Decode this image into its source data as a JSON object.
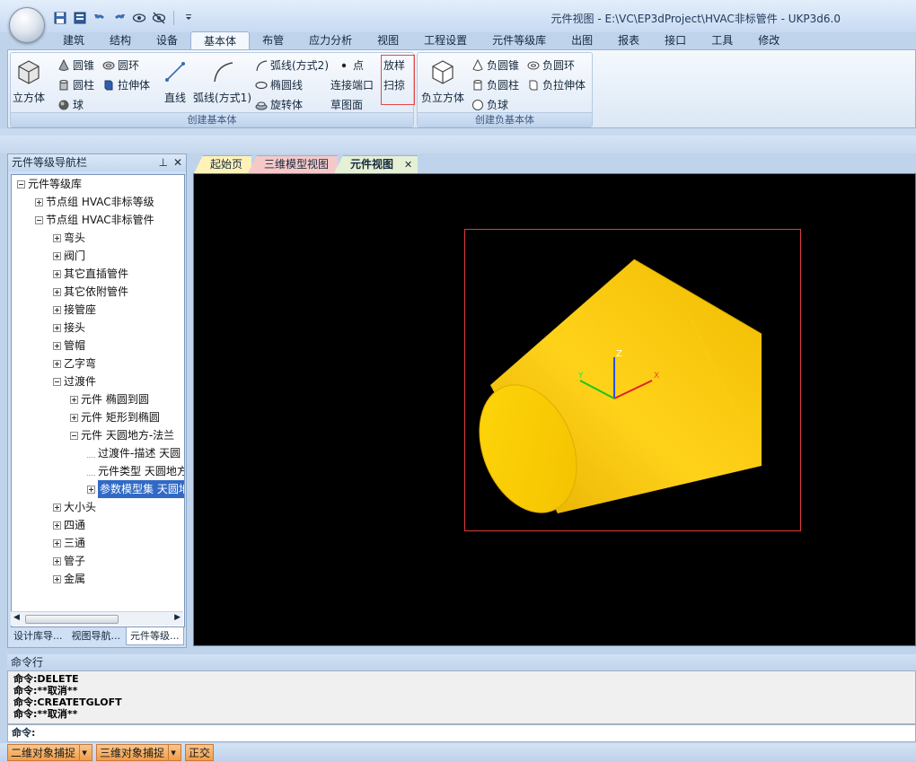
{
  "window": {
    "title": "元件视图 - E:\\VC\\EP3dProject\\HVAC非标管件 - UKP3d6.0"
  },
  "ribbon": {
    "tabs": [
      "建筑",
      "结构",
      "设备",
      "基本体",
      "布管",
      "应力分析",
      "视图",
      "工程设置",
      "元件等级库",
      "出图",
      "报表",
      "接口",
      "工具",
      "修改"
    ],
    "active_tab": "基本体",
    "groups": {
      "create_basic": {
        "label": "创建基本体",
        "cube": "立方体",
        "cone": "圆锥",
        "torus": "圆环",
        "cylinder": "圆柱",
        "extrude": "拉伸体",
        "sphere": "球",
        "line": "直线",
        "arc1": "弧线(方式1)",
        "arc2": "弧线(方式2)",
        "ellipse": "椭圆线",
        "revolve": "旋转体",
        "point": "点",
        "connect_port": "连接端口",
        "sketch": "草图面",
        "loft": "放样",
        "sweep": "扫掠"
      },
      "create_negative": {
        "label": "创建负基本体",
        "neg_cube": "负立方体",
        "neg_cone": "负圆锥",
        "neg_torus": "负圆环",
        "neg_cylinder": "负圆柱",
        "neg_extrude": "负拉伸体",
        "neg_sphere": "负球"
      }
    }
  },
  "nav_panel": {
    "title": "元件等级导航栏",
    "tabs": [
      "设计库导...",
      "视图导航...",
      "元件等级..."
    ],
    "tree": [
      "元件等级库",
      "节点组 HVAC非标等级",
      "节点组 HVAC非标管件",
      "弯头",
      "阀门",
      "其它直插管件",
      "其它依附管件",
      "接管座",
      "接头",
      "管帽",
      "乙字弯",
      "过渡件",
      "元件 椭圆到圆",
      "元件 矩形到椭圆",
      "元件 天圆地方-法兰",
      "过渡件-描述 天圆",
      "元件类型 天圆地方",
      "参数模型集 天圆地",
      "大小头",
      "四通",
      "三通",
      "管子",
      "金属"
    ]
  },
  "doc_tabs": [
    "起始页",
    "三维模型视图",
    "元件视图"
  ],
  "viewport": {
    "axis_labels": {
      "x": "X",
      "y": "Y",
      "z": "Z"
    },
    "colors": {
      "background": "#000000",
      "solid": "#f5c400",
      "selection": "#e03b3b"
    }
  },
  "command": {
    "title": "命令行",
    "history": [
      "命令:DELETE",
      "命令:**取消**",
      "命令:CREATETGLOFT",
      "命令:**取消**"
    ],
    "prompt": "命令:"
  },
  "status": {
    "buttons": [
      "二维对象捕捉",
      "三维对象捕捉",
      "正交"
    ]
  }
}
